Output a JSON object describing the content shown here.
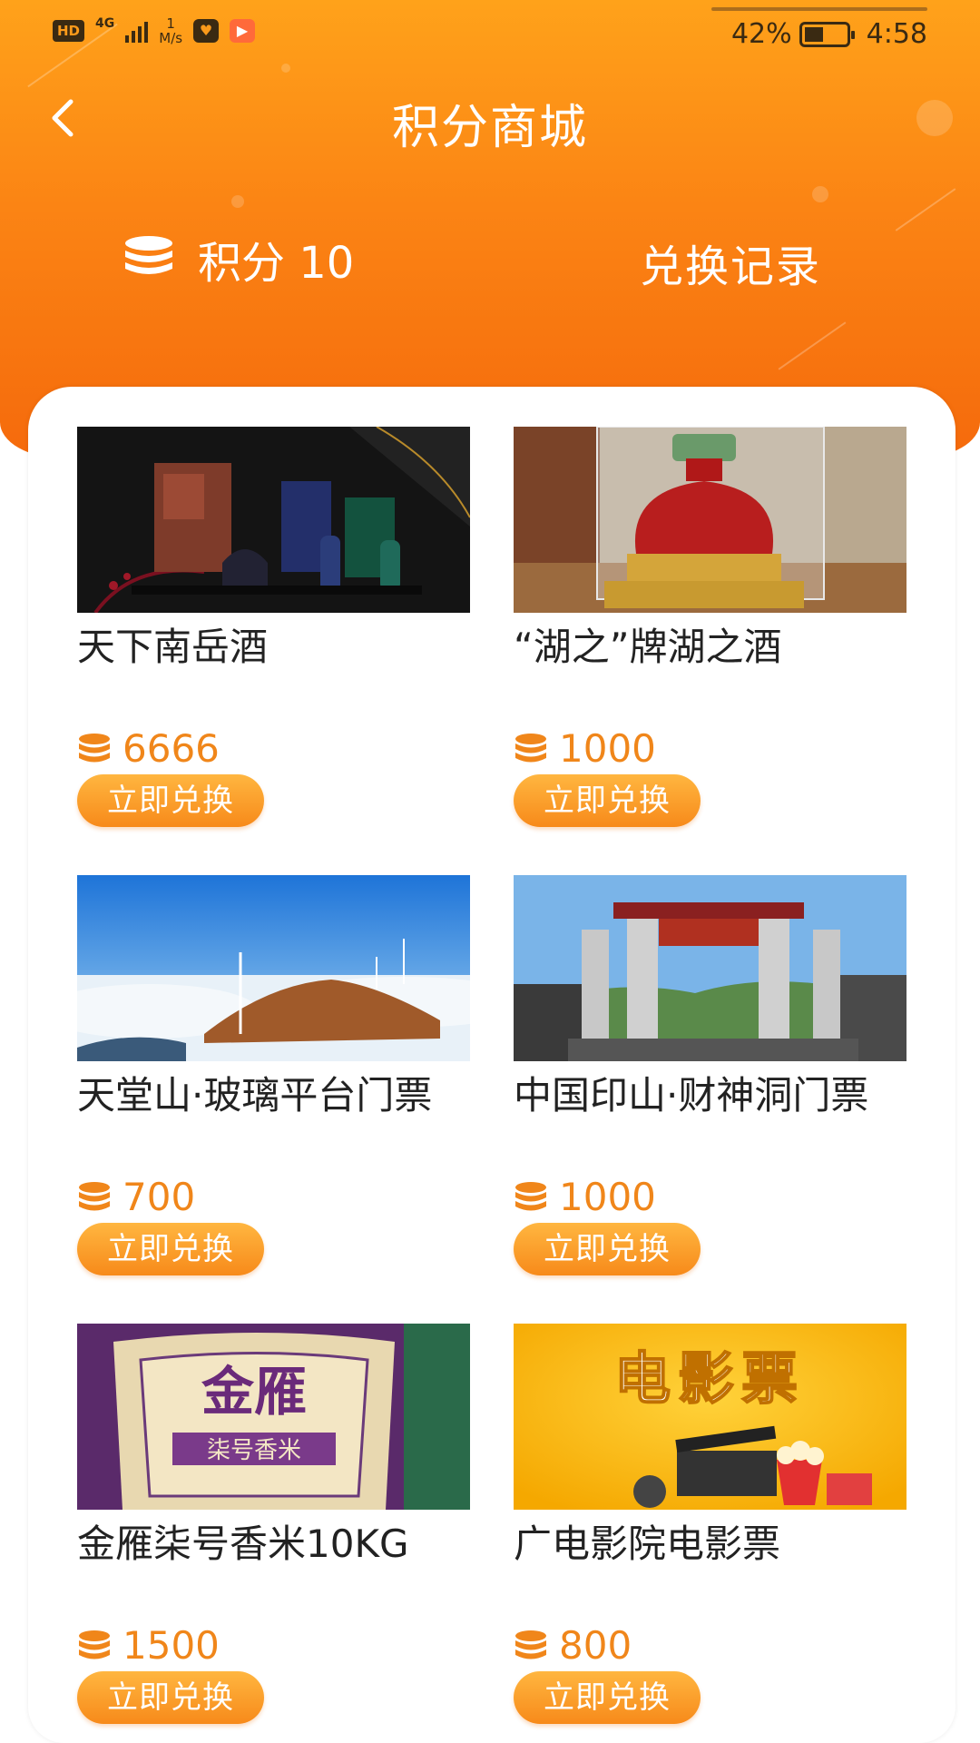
{
  "status_bar": {
    "hd": "HD",
    "network": "4G",
    "speed_value": "1",
    "speed_unit": "M/s",
    "battery_percent": "42%",
    "time": "4:58"
  },
  "header": {
    "title": "积分商城",
    "points_label": "积分 10",
    "records_label": "兑换记录"
  },
  "colors": {
    "accent": "#f78a1a",
    "price": "#f0861a",
    "header_top": "#ffa21a",
    "header_bottom": "#f56a0c"
  },
  "products": [
    {
      "name": "天下南岳酒",
      "price": "6666",
      "button": "立即兑换"
    },
    {
      "name": "“湖之”牌湖之酒",
      "price": "1000",
      "button": "立即兑换"
    },
    {
      "name": "天堂山·玻璃平台门票",
      "price": "700",
      "button": "立即兑换"
    },
    {
      "name": "中国印山·财神洞门票",
      "price": "1000",
      "button": "立即兑换"
    },
    {
      "name": "金雁柒号香米10KG",
      "price": "1500",
      "button": "立即兑换"
    },
    {
      "name": "广电影院电影票",
      "price": "800",
      "button": "立即兑换"
    }
  ],
  "image_text": {
    "movie_banner": "电影票",
    "rice_brand": "金雁",
    "rice_sub": "柒号香米"
  }
}
